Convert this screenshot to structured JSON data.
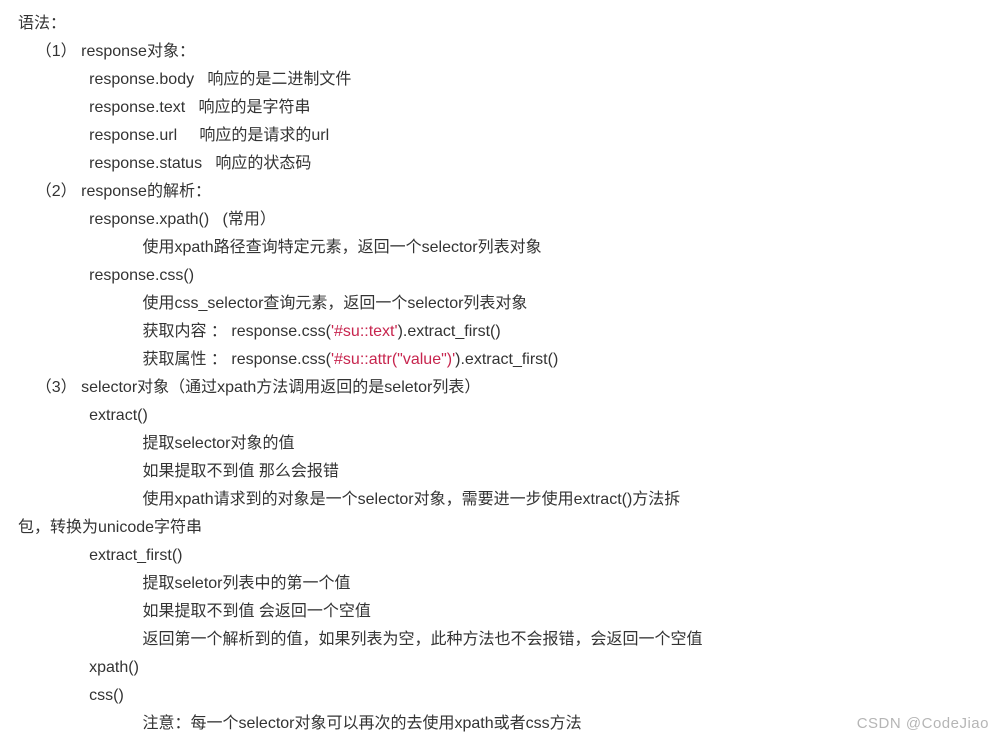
{
  "title": "语法：",
  "s1": {
    "head": "    （1） response对象：",
    "l1a": "                response.body",
    "l1b": "   响应的是二进制文件",
    "l2a": "                response.text",
    "l2b": "   响应的是字符串",
    "l3a": "                response.url",
    "l3b": "     响应的是请求的url",
    "l4a": "                response.status",
    "l4b": "   响应的状态码"
  },
  "s2": {
    "head": "    （2） response的解析：",
    "xpath": "                response.xpath()   (常用）",
    "xpath_desc": "                            使用xpath路径查询特定元素，返回一个selector列表对象",
    "css": "                response.css()",
    "css_desc": "                            使用css_selector查询元素，返回一个selector列表对象",
    "c1a": "                            获取内容 ： response.css(",
    "c1s": "'#su::text'",
    "c1b": ").extract_first()",
    "c2a": "                            获取属性 ： response.css(",
    "c2s": "'#su::attr(\"value\")'",
    "c2b": ").extract_first()"
  },
  "s3": {
    "head": "    （3） selector对象（通过xpath方法调用返回的是seletor列表）",
    "extract": "                extract()",
    "e1": "                            提取selector对象的值",
    "e2": "                            如果提取不到值 那么会报错",
    "e3": "                            使用xpath请求到的对象是一个selector对象，需要进一步使用extract()方法拆",
    "e4": "包，转换为unicode字符串",
    "ef": "                extract_first()",
    "f1": "                            提取seletor列表中的第一个值",
    "f2": "                            如果提取不到值 会返回一个空值",
    "f3": "                            返回第一个解析到的值，如果列表为空，此种方法也不会报错，会返回一个空值",
    "xp": "                xpath()",
    "cs": "                css()",
    "note": "                            注意：每一个selector对象可以再次的去使用xpath或者css方法"
  },
  "watermark": "CSDN @CodeJiao"
}
